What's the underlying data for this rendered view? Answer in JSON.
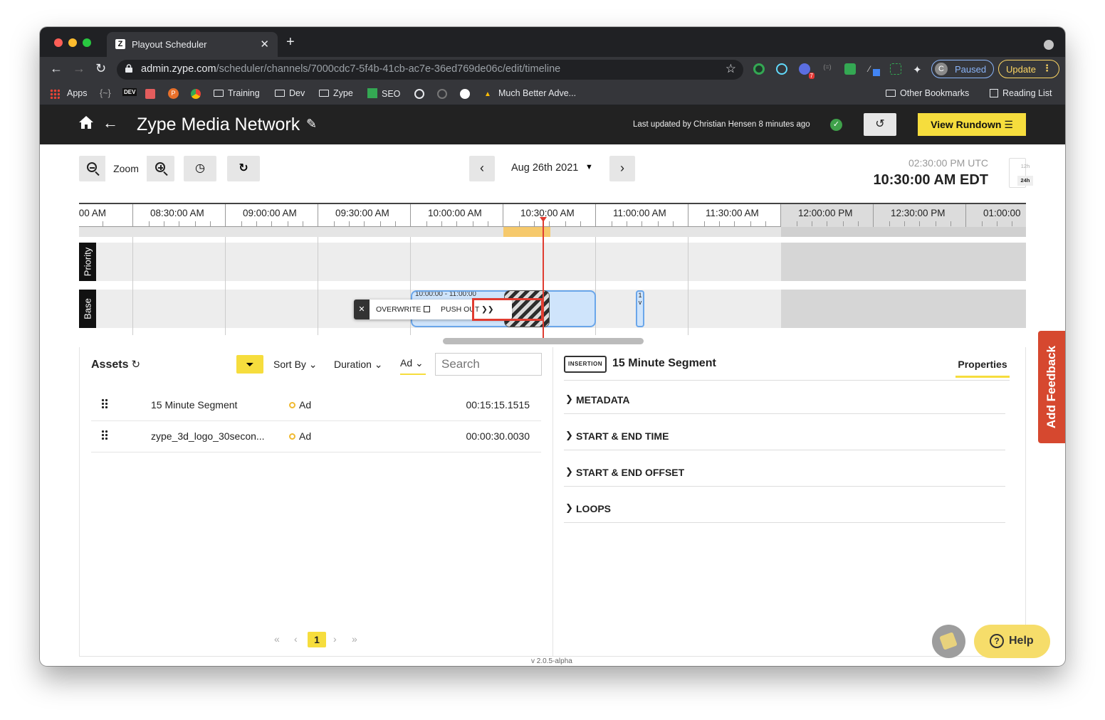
{
  "browser": {
    "tab_title": "Playout Scheduler",
    "tab_favicon": "Z",
    "new_tab": "+",
    "url_host": "admin.zype.com",
    "url_path": "/scheduler/channels/7000cdc7-5f4b-41cb-ac7e-36ed769de06c/edit/timeline",
    "profile_initial": "C",
    "profile_label": "Paused",
    "update_label": "Update",
    "ext_badge": "7",
    "bookmarks": {
      "apps": "Apps",
      "training": "Training",
      "dev": "Dev",
      "zype": "Zype",
      "seo": "SEO",
      "much_better": "Much Better Adve...",
      "other": "Other Bookmarks",
      "reading": "Reading List",
      "devbadge": "DEV",
      "p": "P",
      "braces": "{~}"
    }
  },
  "header": {
    "title": "Zype Media Network",
    "last_updated": "Last updated by Christian Hensen 8 minutes ago",
    "view_rundown": "View Rundown ☰"
  },
  "toolbar": {
    "zoom_label": "Zoom",
    "date": "Aug 26th 2021",
    "utc_time": "02:30:00 PM UTC",
    "local_time": "10:30:00 AM EDT",
    "toggle_12h": "12h",
    "toggle_24h": "24h"
  },
  "timeline": {
    "ticks": [
      ":00 AM",
      "08:30:00 AM",
      "09:00:00 AM",
      "09:30:00 AM",
      "10:00:00 AM",
      "10:30:00 AM",
      "11:00:00 AM",
      "11:30:00 AM",
      "12:00:00 PM",
      "12:30:00 PM",
      "01:00:00"
    ],
    "lanes": {
      "priority": "Priority",
      "base": "Base"
    },
    "block_time": "10:00:00 - 11:00:00",
    "mini_block": "1\nv",
    "drop_menu": {
      "overwrite": "OVERWRITE",
      "push_out": "PUSH OUT ❯❯"
    }
  },
  "assets": {
    "title": "Assets",
    "sort_by": "Sort By",
    "duration": "Duration",
    "type_filter": "Ad",
    "search_placeholder": "Search",
    "rows": [
      {
        "name": "15 Minute Segment",
        "type": "Ad",
        "duration": "00:15:15.1515"
      },
      {
        "name": "zype_3d_logo_30secon...",
        "type": "Ad",
        "duration": "00:00:30.0030"
      }
    ],
    "pagination": {
      "first": "«",
      "prev": "‹",
      "current": "1",
      "next": "›",
      "last": "»"
    }
  },
  "properties": {
    "badge": "INSERTION",
    "title": "15 Minute Segment",
    "tab": "Properties",
    "sections": [
      "METADATA",
      "START & END TIME",
      "START & END OFFSET",
      "LOOPS"
    ]
  },
  "version": "v 2.0.5-alpha",
  "feedback": "Add Feedback",
  "help": "Help",
  "colors": {
    "accent_yellow": "#f6dd3d",
    "header_bg": "#222222",
    "feedback_red": "#d6482f",
    "playhead_red": "#e03c31",
    "block_blue": "#cfe4fb"
  }
}
